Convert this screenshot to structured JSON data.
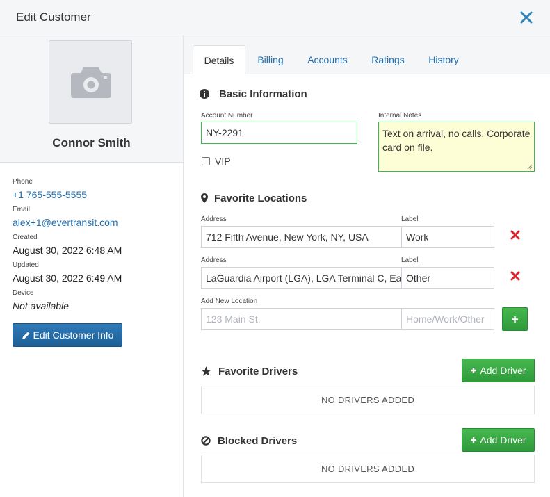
{
  "header": {
    "title": "Edit Customer"
  },
  "customer": {
    "name": "Connor Smith",
    "fields": [
      {
        "label": "Phone",
        "value": "+1 765-555-5555"
      },
      {
        "label": "Email",
        "value": "alex+1@evertransit.com"
      },
      {
        "label": "Created",
        "value": "August 30, 2022 6:48 AM"
      },
      {
        "label": "Updated",
        "value": "August 30, 2022 6:49 AM"
      },
      {
        "label": "Device",
        "value": "Not available"
      }
    ],
    "edit_button": "Edit Customer Info"
  },
  "tabs": [
    {
      "label": "Details",
      "active": true
    },
    {
      "label": "Billing",
      "active": false
    },
    {
      "label": "Accounts",
      "active": false
    },
    {
      "label": "Ratings",
      "active": false
    },
    {
      "label": "History",
      "active": false
    }
  ],
  "basic_info": {
    "title": "Basic Information",
    "account_number_label": "Account Number",
    "account_number_value": "NY-2291",
    "internal_notes_label": "Internal Notes",
    "internal_notes_value": "Text on arrival, no calls. Corporate card on file.",
    "vip_label": "VIP",
    "vip_checked": false
  },
  "favorite_locations": {
    "title": "Favorite Locations",
    "address_label": "Address",
    "label_label": "Label",
    "items": [
      {
        "address": "712 Fifth Avenue, New York, NY, USA",
        "label": "Work"
      },
      {
        "address": "LaGuardia Airport (LGA), LGA Terminal C, East Elmhurst, NY, USA",
        "label": "Other"
      }
    ],
    "add_new_label": "Add New Location",
    "address_placeholder": "123 Main St.",
    "label_placeholder": "Home/Work/Other"
  },
  "favorite_drivers": {
    "title": "Favorite Drivers",
    "add_button": "Add Driver",
    "empty_text": "NO DRIVERS ADDED"
  },
  "blocked_drivers": {
    "title": "Blocked Drivers",
    "add_button": "Add Driver",
    "empty_text": "NO DRIVERS ADDED"
  },
  "colors": {
    "link": "#1f6fb2",
    "primary_button": "#1d5f96",
    "success_button": "#2f9a3a",
    "valid_border": "#3cb94a",
    "remove": "#d9232d"
  }
}
